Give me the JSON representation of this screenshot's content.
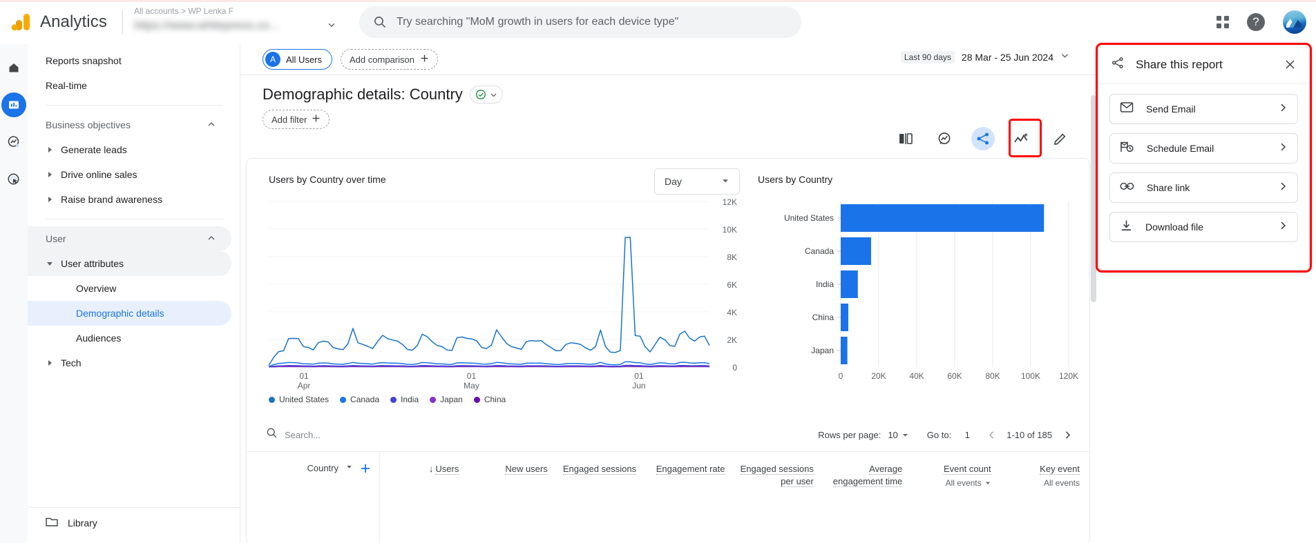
{
  "topbar": {
    "brand": "Analytics",
    "account_breadcrumb": "All accounts  >  WP Lenka F",
    "account_name": "https://www.whitepress.co...",
    "search_placeholder": "Try searching \"MoM growth in users for each device type\"",
    "help_glyph": "?",
    "apps_tooltip": "Google apps"
  },
  "rail": {
    "items": [
      {
        "name": "home",
        "label": "Home",
        "active": false
      },
      {
        "name": "reports",
        "label": "Reports",
        "active": true
      },
      {
        "name": "explore",
        "label": "Explore",
        "active": false
      },
      {
        "name": "advertising",
        "label": "Advertising",
        "active": false
      }
    ]
  },
  "sidebar": {
    "items": [
      {
        "label": "Reports snapshot",
        "level": 0,
        "state": "normal"
      },
      {
        "label": "Real-time",
        "level": 0,
        "state": "normal"
      }
    ],
    "business_objectives": {
      "label": "Business objectives",
      "expanded": true,
      "children": [
        {
          "label": "Generate leads"
        },
        {
          "label": "Drive online sales"
        },
        {
          "label": "Raise brand awareness"
        }
      ]
    },
    "user_group": {
      "label": "User",
      "expanded": true,
      "attributes": {
        "label": "User attributes",
        "expanded": true,
        "children": [
          {
            "label": "Overview",
            "selected": false
          },
          {
            "label": "Demographic details",
            "selected": true
          },
          {
            "label": "Audiences",
            "selected": false
          }
        ]
      },
      "tech": {
        "label": "Tech"
      }
    },
    "library_label": "Library"
  },
  "report": {
    "segment_chip": {
      "initial": "A",
      "label": "All Users"
    },
    "add_comparison_label": "Add comparison",
    "date_badge": "Last 90 days",
    "date_range": "28 Mar - 25 Jun 2024",
    "title": "Demographic details: Country",
    "add_filter_label": "Add filter",
    "toolbar": [
      {
        "name": "compare-icon",
        "label": "Compare"
      },
      {
        "name": "insights-icon",
        "label": "Insights"
      },
      {
        "name": "share-icon",
        "label": "Share this report",
        "highlighted": true
      },
      {
        "name": "trends-icon",
        "label": "Trends"
      },
      {
        "name": "edit-icon",
        "label": "Edit / Customise report"
      }
    ]
  },
  "share_panel": {
    "title": "Share this report",
    "close_glyph": "✕",
    "options": [
      {
        "icon": "mail-icon",
        "label": "Send Email",
        "chevron": "›"
      },
      {
        "icon": "schedule-email-icon",
        "label": "Schedule Email",
        "chevron": "›"
      },
      {
        "icon": "link-icon",
        "label": "Share link",
        "chevron": "›"
      },
      {
        "icon": "download-icon",
        "label": "Download file",
        "chevron": "›"
      }
    ]
  },
  "table": {
    "search_placeholder": "Search...",
    "rows_per_page_label": "Rows per page:",
    "rows_per_page_value": "10",
    "goto_label": "Go to:",
    "goto_value": "1",
    "range_text": "1-10 of 185",
    "dimension": "Country",
    "columns": [
      {
        "label": "Users",
        "sub": "",
        "sorted": true
      },
      {
        "label": "New users",
        "sub": ""
      },
      {
        "label": "Engaged sessions",
        "sub": ""
      },
      {
        "label": "Engagement rate",
        "sub": ""
      },
      {
        "label": "Engaged sessions per user",
        "sub": ""
      },
      {
        "label": "Average engagement time",
        "sub": ""
      },
      {
        "label": "Event count",
        "sub": "All events"
      },
      {
        "label": "Key event",
        "sub": "All events"
      }
    ]
  },
  "chart_data": [
    {
      "type": "line",
      "title": "Users by Country over time",
      "granularity_label": "Day",
      "xlabel": "",
      "ylabel": "",
      "ylim": [
        0,
        12000
      ],
      "yticks": [
        0,
        2000,
        4000,
        6000,
        8000,
        10000,
        12000
      ],
      "ytick_labels": [
        "0",
        "2K",
        "4K",
        "6K",
        "8K",
        "10K",
        "12K"
      ],
      "xtick_labels": [
        "01\nApr",
        "01\nMay",
        "01\nJun"
      ],
      "xtick_positions": [
        0.08,
        0.46,
        0.84
      ],
      "grid": true,
      "legend_position": "bottom",
      "series": [
        {
          "name": "United States",
          "color": "#1a73c9",
          "values": [
            120,
            700,
            1120,
            1180,
            2060,
            2080,
            2060,
            1480,
            1420,
            1240,
            1760,
            1880,
            1820,
            1420,
            1320,
            1260,
            1680,
            2800,
            1760,
            1640,
            1500,
            1340,
            1860,
            2300,
            2060,
            1960,
            1880,
            1640,
            1280,
            1220,
            1560,
            2380,
            2200,
            1840,
            1560,
            1480,
            1240,
            1200,
            2120,
            2180,
            2080,
            2040,
            1900,
            1420,
            1340,
            1600,
            2700,
            2200,
            1720,
            1480,
            1380,
            1280,
            1840,
            1920,
            1880,
            1920,
            1640,
            1420,
            1180,
            1200,
            1640,
            1760,
            1720,
            1640,
            1380,
            1220,
            1480,
            2680,
            1480,
            1080,
            1060,
            1200,
            9400,
            9400,
            2280,
            2240,
            1480,
            1100,
            1620,
            2160,
            1980,
            1560,
            1500,
            2380,
            2600,
            2100,
            1880,
            2180,
            2240,
            1560
          ]
        },
        {
          "name": "Canada",
          "color": "#1a73e8",
          "values": [
            40,
            180,
            260,
            290,
            330,
            320,
            300,
            240,
            230,
            210,
            280,
            300,
            290,
            230,
            210,
            200,
            260,
            340,
            280,
            260,
            240,
            210,
            290,
            320,
            300,
            290,
            280,
            250,
            200,
            190,
            240,
            330,
            310,
            280,
            240,
            230,
            200,
            190,
            300,
            310,
            300,
            290,
            270,
            220,
            210,
            250,
            340,
            310,
            260,
            230,
            220,
            200,
            280,
            290,
            280,
            290,
            250,
            220,
            190,
            190,
            250,
            260,
            260,
            250,
            220,
            200,
            230,
            340,
            230,
            180,
            170,
            190,
            380,
            380,
            320,
            310,
            230,
            180,
            250,
            310,
            290,
            240,
            230,
            330,
            350,
            300,
            280,
            310,
            320,
            240
          ]
        },
        {
          "name": "India",
          "color": "#4343d5",
          "values": [
            20,
            60,
            90,
            95,
            110,
            105,
            100,
            80,
            78,
            70,
            92,
            100,
            96,
            78,
            70,
            68,
            86,
            112,
            94,
            86,
            80,
            70,
            96,
            106,
            100,
            96,
            92,
            84,
            68,
            64,
            80,
            110,
            104,
            94,
            80,
            78,
            68,
            64,
            100,
            104,
            100,
            96,
            90,
            74,
            70,
            84,
            112,
            104,
            86,
            78,
            74,
            68,
            94,
            96,
            94,
            96,
            84,
            74,
            64,
            64,
            84,
            88,
            86,
            84,
            74,
            68,
            78,
            112,
            78,
            60,
            58,
            64,
            126,
            126,
            106,
            104,
            78,
            60,
            84,
            104,
            96,
            80,
            78,
            110,
            116,
            100,
            94,
            104,
            106,
            80
          ]
        },
        {
          "name": "Japan",
          "color": "#8430ce",
          "values": [
            10,
            28,
            42,
            44,
            52,
            50,
            48,
            38,
            36,
            34,
            44,
            48,
            46,
            36,
            34,
            32,
            40,
            54,
            44,
            40,
            38,
            34,
            46,
            50,
            48,
            46,
            44,
            40,
            32,
            30,
            38,
            52,
            50,
            44,
            38,
            36,
            32,
            30,
            48,
            50,
            48,
            46,
            42,
            36,
            34,
            40,
            54,
            50,
            40,
            36,
            34,
            32,
            44,
            46,
            44,
            46,
            40,
            36,
            30,
            30,
            40,
            42,
            40,
            40,
            36,
            32,
            36,
            54,
            36,
            28,
            28,
            30,
            60,
            60,
            50,
            50,
            36,
            28,
            40,
            50,
            46,
            38,
            36,
            52,
            56,
            48,
            44,
            50,
            50,
            38
          ]
        },
        {
          "name": "China",
          "color": "#6a0dad",
          "values": [
            8,
            22,
            34,
            36,
            42,
            40,
            38,
            30,
            29,
            27,
            36,
            38,
            37,
            29,
            27,
            26,
            32,
            44,
            36,
            32,
            30,
            27,
            37,
            40,
            38,
            37,
            36,
            32,
            26,
            24,
            30,
            42,
            40,
            36,
            30,
            29,
            26,
            24,
            38,
            40,
            38,
            37,
            34,
            29,
            27,
            32,
            44,
            40,
            32,
            29,
            27,
            26,
            36,
            37,
            36,
            37,
            32,
            29,
            24,
            24,
            32,
            34,
            32,
            32,
            29,
            26,
            29,
            44,
            29,
            22,
            22,
            24,
            48,
            48,
            40,
            40,
            29,
            22,
            32,
            40,
            37,
            30,
            29,
            42,
            45,
            38,
            36,
            40,
            40,
            30
          ]
        }
      ]
    },
    {
      "type": "bar",
      "orientation": "horizontal",
      "title": "Users by Country",
      "categories": [
        "United States",
        "Canada",
        "India",
        "China",
        "Japan"
      ],
      "values": [
        107000,
        16000,
        9000,
        4000,
        3500
      ],
      "bar_color": "#1a73e8",
      "xlim": [
        0,
        120000
      ],
      "xticks": [
        0,
        20000,
        40000,
        60000,
        80000,
        100000,
        120000
      ],
      "xtick_labels": [
        "0",
        "20K",
        "40K",
        "60K",
        "80K",
        "100K",
        "120K"
      ],
      "grid": true
    }
  ],
  "colors": {
    "accent_blue": "#1a73e8",
    "selected_bg": "#e8f0fe",
    "highlight_red": "#ff0000",
    "text_primary": "#202124",
    "text_secondary": "#5f6368",
    "border": "#e8eaed"
  }
}
